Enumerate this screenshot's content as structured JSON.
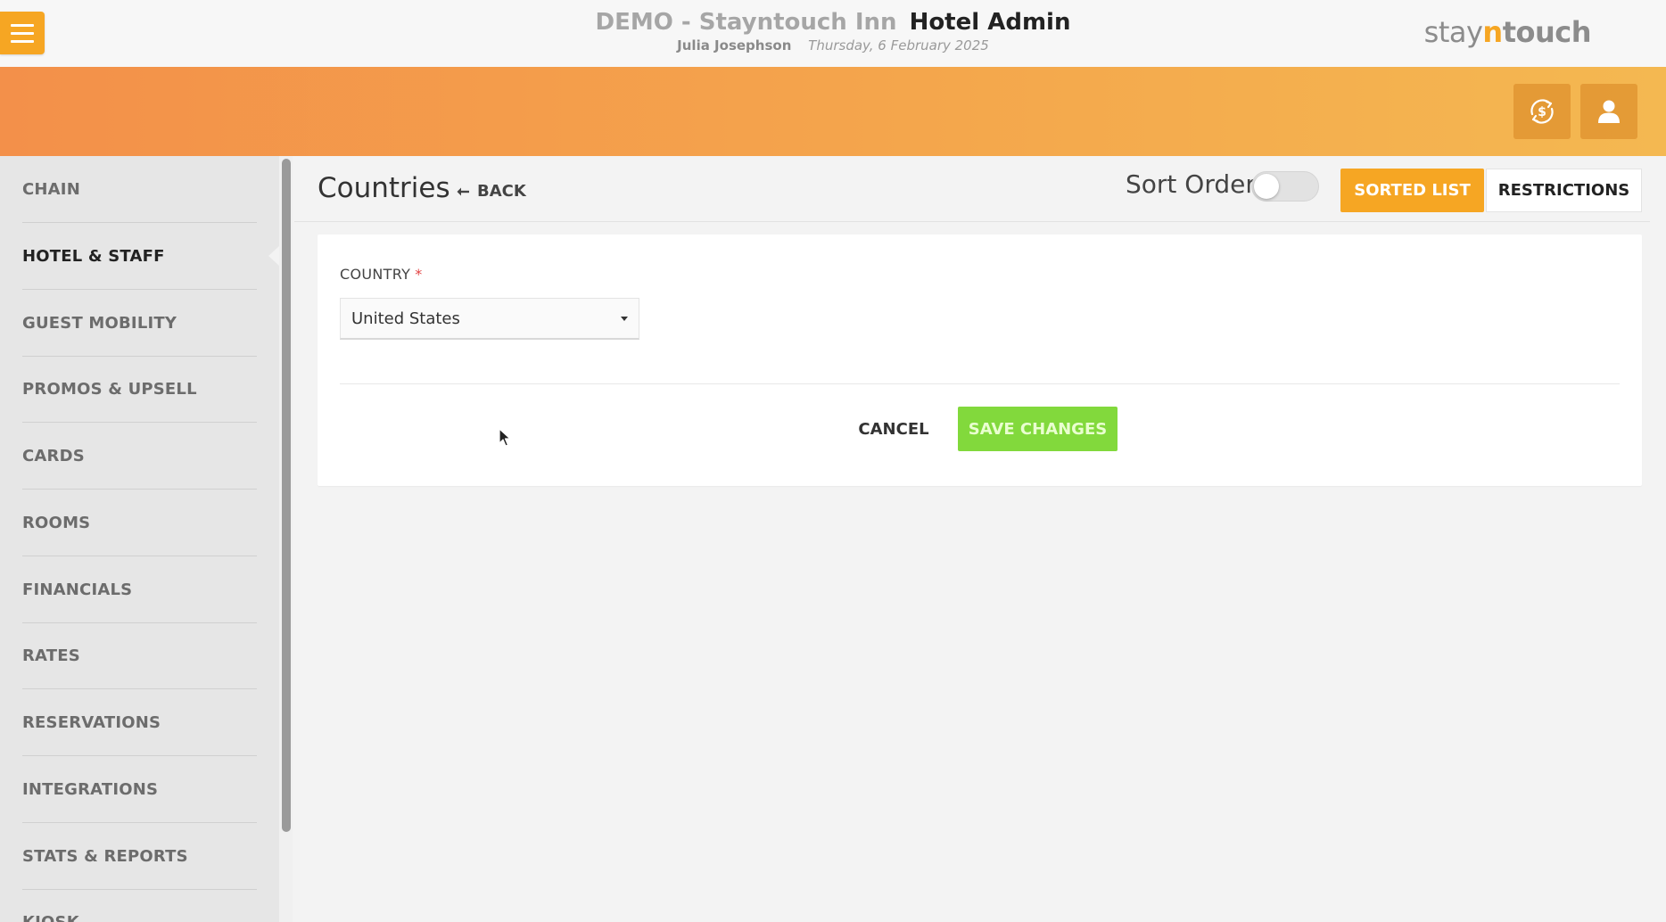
{
  "header": {
    "hotel_name": "DEMO - Stayntouch Inn",
    "app_name": "Hotel Admin",
    "user_name": "Julia Josephson",
    "date": "Thursday, 6 February 2025",
    "brand": {
      "part1": "stay",
      "part2": "n",
      "part3": "touch"
    },
    "menu_icon": "hamburger-icon",
    "band_buttons": [
      {
        "icon": "dollar-swap-icon"
      },
      {
        "icon": "user-icon"
      }
    ]
  },
  "sidebar": {
    "items": [
      {
        "label": "CHAIN",
        "active": false
      },
      {
        "label": "HOTEL & STAFF",
        "active": true
      },
      {
        "label": "GUEST MOBILITY",
        "active": false
      },
      {
        "label": "PROMOS & UPSELL",
        "active": false
      },
      {
        "label": "CARDS",
        "active": false
      },
      {
        "label": "ROOMS",
        "active": false
      },
      {
        "label": "FINANCIALS",
        "active": false
      },
      {
        "label": "RATES",
        "active": false
      },
      {
        "label": "RESERVATIONS",
        "active": false
      },
      {
        "label": "INTEGRATIONS",
        "active": false
      },
      {
        "label": "STATS & REPORTS",
        "active": false
      },
      {
        "label": "KIOSK",
        "active": false
      }
    ]
  },
  "main": {
    "title": "Countries",
    "back_label": "BACK",
    "sort_order_label": "Sort Order",
    "sort_order_enabled": false,
    "tabs": [
      {
        "label": "SORTED LIST",
        "active": true
      },
      {
        "label": "RESTRICTIONS",
        "active": false
      }
    ],
    "form": {
      "country_label": "COUNTRY",
      "required_mark": "*",
      "country_value": "United States",
      "cancel_label": "CANCEL",
      "save_label": "SAVE CHANGES"
    }
  },
  "colors": {
    "accent": "#f6a623",
    "save_green": "#82d93c",
    "band_start": "#f3904a",
    "band_end": "#f4b851"
  }
}
